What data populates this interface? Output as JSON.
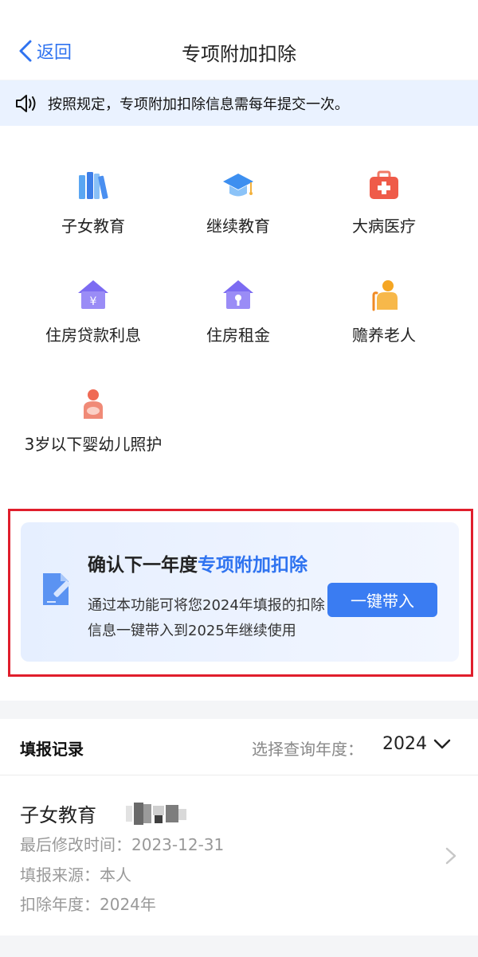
{
  "nav": {
    "back_label": "返回",
    "title": "专项附加扣除"
  },
  "notice": {
    "text": "按照规定，专项附加扣除信息需每年提交一次。"
  },
  "categories": [
    {
      "label": "子女教育",
      "icon": "books-icon"
    },
    {
      "label": "继续教育",
      "icon": "graduation-cap-icon"
    },
    {
      "label": "大病医疗",
      "icon": "medical-kit-icon"
    },
    {
      "label": "住房贷款利息",
      "icon": "house-yuan-icon"
    },
    {
      "label": "住房租金",
      "icon": "house-key-icon"
    },
    {
      "label": "赡养老人",
      "icon": "elderly-person-icon"
    },
    {
      "label": "3岁以下婴幼儿照护",
      "icon": "mother-baby-icon"
    }
  ],
  "promo": {
    "title_prefix": "确认下一年度",
    "title_highlight": "专项附加扣除",
    "description": "通过本功能可将您2024年填报的扣除信息一键带入到2025年继续使用",
    "button_label": "一键带入"
  },
  "records": {
    "title": "填报记录",
    "year_label": "选择查询年度：",
    "year_value": "2024",
    "items": [
      {
        "name": "子女教育",
        "modified": "最后修改时间：2023-12-31",
        "source": "填报来源：本人",
        "year": "扣除年度：2024年"
      }
    ]
  },
  "colors": {
    "accent": "#2f73f0",
    "button": "#3a7cf2",
    "highlight_border": "#e01e2c"
  }
}
